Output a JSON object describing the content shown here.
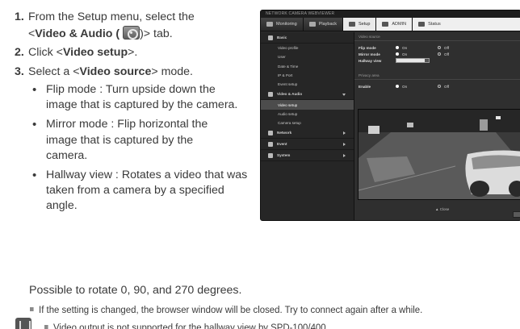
{
  "steps": [
    {
      "num": "1.",
      "a": "From the Setup menu, select the",
      "b_pre": "<",
      "b_bold": "Video & Audio (",
      "b_post": ")> tab."
    },
    {
      "num": "2.",
      "pre": "Click <",
      "bold": "Video setup",
      "post": ">."
    },
    {
      "num": "3.",
      "pre": "Select a <",
      "bold": "Video source",
      "post": "> mode."
    }
  ],
  "bullets": [
    "Flip mode : Turn upside down the image that is captured by the camera.",
    "Mirror mode : Flip horizontal the image that is captured by the camera.",
    "Hallway view : Rotates a video that was taken from a camera by a specified angle."
  ],
  "rotate_note": "Possible to rotate 0, 90, and 270 degrees.",
  "square_note": "If the setting is changed, the browser window will be closed. Try to connect again after a while.",
  "note_text": "Video output is not supported for the hallway view by SPD-100/400.",
  "viewer": {
    "title": "NETWORK CAMERA WEBVIEWER",
    "tabs": [
      "Monitoring",
      "Playback",
      "Setup",
      "ADMIN",
      "Status"
    ],
    "sidebar": {
      "basic": "Basic",
      "basic_items": [
        "Video profile",
        "User",
        "Date & Time",
        "IP & Port",
        "Event setup"
      ],
      "video_audio": "Video & Audio",
      "va_items": [
        "Video setup",
        "Audio setup",
        "Camera setup"
      ],
      "network": "Network",
      "event": "Event",
      "system": "System"
    },
    "sections": {
      "video_source": "Video source",
      "privacy_area": "Privacy area"
    },
    "rows": {
      "flip": "Flip mode",
      "mirror": "Mirror mode",
      "hallway": "Hallway view",
      "enable": "Enable",
      "on": "On",
      "off": "Off",
      "hallway_value": "0 degree"
    },
    "close": "Close"
  },
  "colors": {
    "text": "#3a3a3a",
    "viewer_bg": "#2b2b2b",
    "tab_active": "#e9e9e9"
  }
}
